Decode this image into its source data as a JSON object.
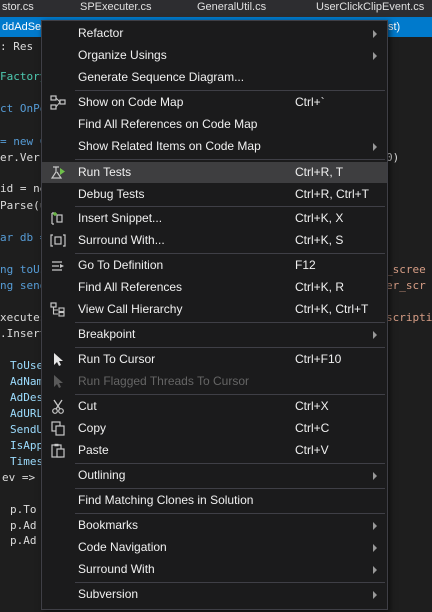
{
  "tabs": [
    {
      "label": "stor.cs"
    },
    {
      "label": "SPExecuter.cs"
    },
    {
      "label": "GeneralUtil.cs"
    },
    {
      "label": "UserClickClipEvent.cs"
    }
  ],
  "active_tab": {
    "label": "ddAdSer",
    "suffix": "st)"
  },
  "code_fragments": {
    "l1": ": Res",
    "l2": "Factory",
    "l3": "ct OnPo",
    "l4a": "= new C",
    "l4b": "er.Ver",
    "l4c": "0)",
    "l5a": "id = ne",
    "l5b": "Parse(u",
    "l6": "ar db =",
    "l7a": "ng toUs",
    "l7b": "_scree",
    "l8a": "ng send",
    "l8b": "er_scr",
    "l9a": "xecutes",
    "l9b": "scripti",
    "l10": ".Insert",
    "l11": "ToUser",
    "l12": "AdName",
    "l13": "AdDesc",
    "l14": "AdURL",
    "l15": "SendU",
    "l16": "IsApp",
    "l17": "Times",
    "l18": "ev =>",
    "l19": "p.To",
    "l20": "p.Ad",
    "l21": "p.Ad"
  },
  "menu": {
    "items": [
      {
        "label": "Refactor",
        "shortcut": "",
        "submenu": true
      },
      {
        "label": "Organize Usings",
        "shortcut": "",
        "submenu": true
      },
      {
        "label": "Generate Sequence Diagram...",
        "shortcut": "",
        "submenu": false
      },
      {
        "label": "Show on Code Map",
        "shortcut": "Ctrl+`",
        "submenu": false,
        "icon": "code-map-icon"
      },
      {
        "label": "Find All References on Code Map",
        "shortcut": "",
        "submenu": false
      },
      {
        "label": "Show Related Items on Code Map",
        "shortcut": "",
        "submenu": true
      },
      {
        "label": "Run Tests",
        "shortcut": "Ctrl+R, T",
        "submenu": false,
        "icon": "run-tests-icon",
        "highlighted": true
      },
      {
        "label": "Debug Tests",
        "shortcut": "Ctrl+R, Ctrl+T",
        "submenu": false
      },
      {
        "label": "Insert Snippet...",
        "shortcut": "Ctrl+K, X",
        "submenu": false,
        "icon": "insert-snippet-icon"
      },
      {
        "label": "Surround With...",
        "shortcut": "Ctrl+K, S",
        "submenu": false,
        "icon": "surround-with-icon"
      },
      {
        "label": "Go To Definition",
        "shortcut": "F12",
        "submenu": false,
        "icon": "go-to-definition-icon"
      },
      {
        "label": "Find All References",
        "shortcut": "Ctrl+K, R",
        "submenu": false
      },
      {
        "label": "View Call Hierarchy",
        "shortcut": "Ctrl+K, Ctrl+T",
        "submenu": false,
        "icon": "call-hierarchy-icon"
      },
      {
        "label": "Breakpoint",
        "shortcut": "",
        "submenu": true
      },
      {
        "label": "Run To Cursor",
        "shortcut": "Ctrl+F10",
        "submenu": false,
        "icon": "cursor-arrow-icon"
      },
      {
        "label": "Run Flagged Threads To Cursor",
        "shortcut": "",
        "submenu": false,
        "icon": "cursor-arrow-icon",
        "disabled": true
      },
      {
        "label": "Cut",
        "shortcut": "Ctrl+X",
        "submenu": false,
        "icon": "scissors-icon"
      },
      {
        "label": "Copy",
        "shortcut": "Ctrl+C",
        "submenu": false,
        "icon": "copy-icon"
      },
      {
        "label": "Paste",
        "shortcut": "Ctrl+V",
        "submenu": false,
        "icon": "paste-icon"
      },
      {
        "label": "Outlining",
        "shortcut": "",
        "submenu": true
      },
      {
        "label": "Find Matching Clones in Solution",
        "shortcut": "",
        "submenu": false
      },
      {
        "label": "Bookmarks",
        "shortcut": "",
        "submenu": true
      },
      {
        "label": "Code Navigation",
        "shortcut": "",
        "submenu": true
      },
      {
        "label": "Surround With",
        "shortcut": "",
        "submenu": true
      },
      {
        "label": "Subversion",
        "shortcut": "",
        "submenu": true
      }
    ]
  },
  "colors": {
    "menu_bg": "#1b1b1c",
    "highlight": "#3e3e40",
    "accent": "#007acc",
    "editor_bg": "#1e1e1e"
  }
}
